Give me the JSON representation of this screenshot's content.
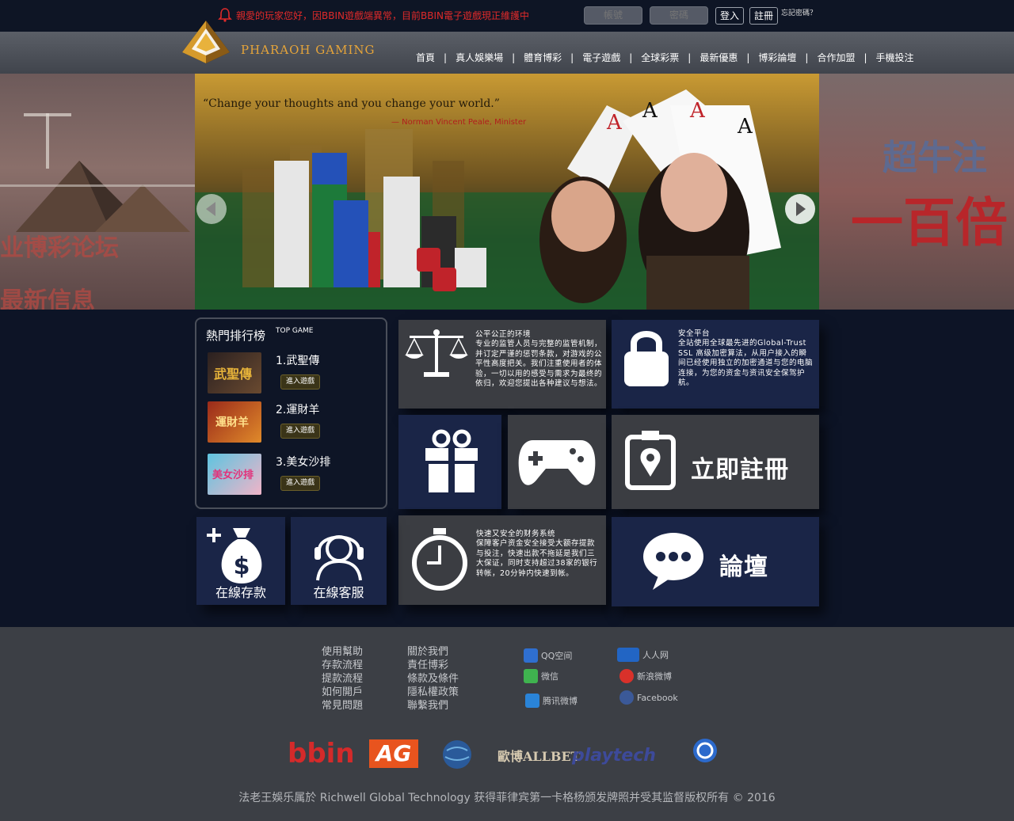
{
  "notice": "親愛的玩家您好，因BBIN遊戲端異常，目前BBIN電子遊戲現正維護中",
  "login": {
    "account_placeholder": "帳號",
    "password_placeholder": "密碼",
    "login_label": "登入",
    "register_label": "註冊",
    "forgot_label": "忘記密碼？"
  },
  "brand": "PHARAOH GAMING",
  "nav": [
    "首頁",
    "真人娛樂場",
    "體育博彩",
    "電子遊戲",
    "全球彩票",
    "最新優惠",
    "博彩論壇",
    "合作加盟",
    "手機投注"
  ],
  "banner": {
    "quote": "“Change your thoughts and you change your world.”",
    "author": "— Norman Vincent Peale, Minister",
    "left_texts": [
      "业博彩论坛",
      "最新信息"
    ],
    "right_texts": [
      "超牛注",
      "一百倍"
    ]
  },
  "ranking": {
    "title": "熱門排行榜",
    "subtitle": "TOP GAME",
    "enter_label": "進入遊戲",
    "games": [
      {
        "name": "1.武聖傳",
        "thumb": "武聖傳"
      },
      {
        "name": "2.運財羊",
        "thumb": "運財羊"
      },
      {
        "name": "3.美女沙排",
        "thumb": "美女沙排"
      }
    ]
  },
  "tiles": {
    "fair": {
      "title": "公平公正的环境",
      "text": "专业的监管人员与完整的监管机制，并订定严谨的惩罚条款，对游戏的公平性高度把关。我们注重使用者的体验，一切以用的感受与需求为最终的依归，欢迎您提出各种建议与想法。"
    },
    "secure": {
      "title": "安全平台",
      "text": "全站使用全球最先进的Global-Trust SSL 高级加密算法，从用户接入的瞬间已经使用独立的加密通道与您的电脑连接，为您的资金与资讯安全保驾护航。"
    },
    "register": "立即註冊",
    "finance": {
      "title": "快速又安全的财务系统",
      "text": "保障客户资金安全接受大额存提款与投注，快速出款不拖延是我们三大保证，同时支持超过38家的银行转帐，20分钟内快速到帐。"
    },
    "forum": "論壇",
    "deposit": "在線存款",
    "support": "在線客服"
  },
  "footer": {
    "col1": [
      "使用幫助",
      "存款流程",
      "提款流程",
      "如何開戶",
      "常見問題"
    ],
    "col2": [
      "關於我們",
      "責任博彩",
      "條款及條件",
      "隱私權政策",
      "聯繫我們"
    ],
    "social_left": [
      "QQ空间",
      "微信",
      "腾讯微博"
    ],
    "social_right": [
      "人人网",
      "新浪微博",
      "Facebook"
    ],
    "partners": [
      "bbin",
      "AG",
      "",
      "歐博ALLBET",
      "playtech",
      ""
    ],
    "copyright": "法老王娛乐属於 Richwell Global Technology 获得菲律宾第一卡格杨颁发牌照并受其监督版权所有 © 2016"
  },
  "colors": {
    "accent_gold": "#e5a43a",
    "notice_red": "#e02a2a",
    "tile_navy": "#1a2547",
    "tile_dark": "#3b3d42"
  }
}
